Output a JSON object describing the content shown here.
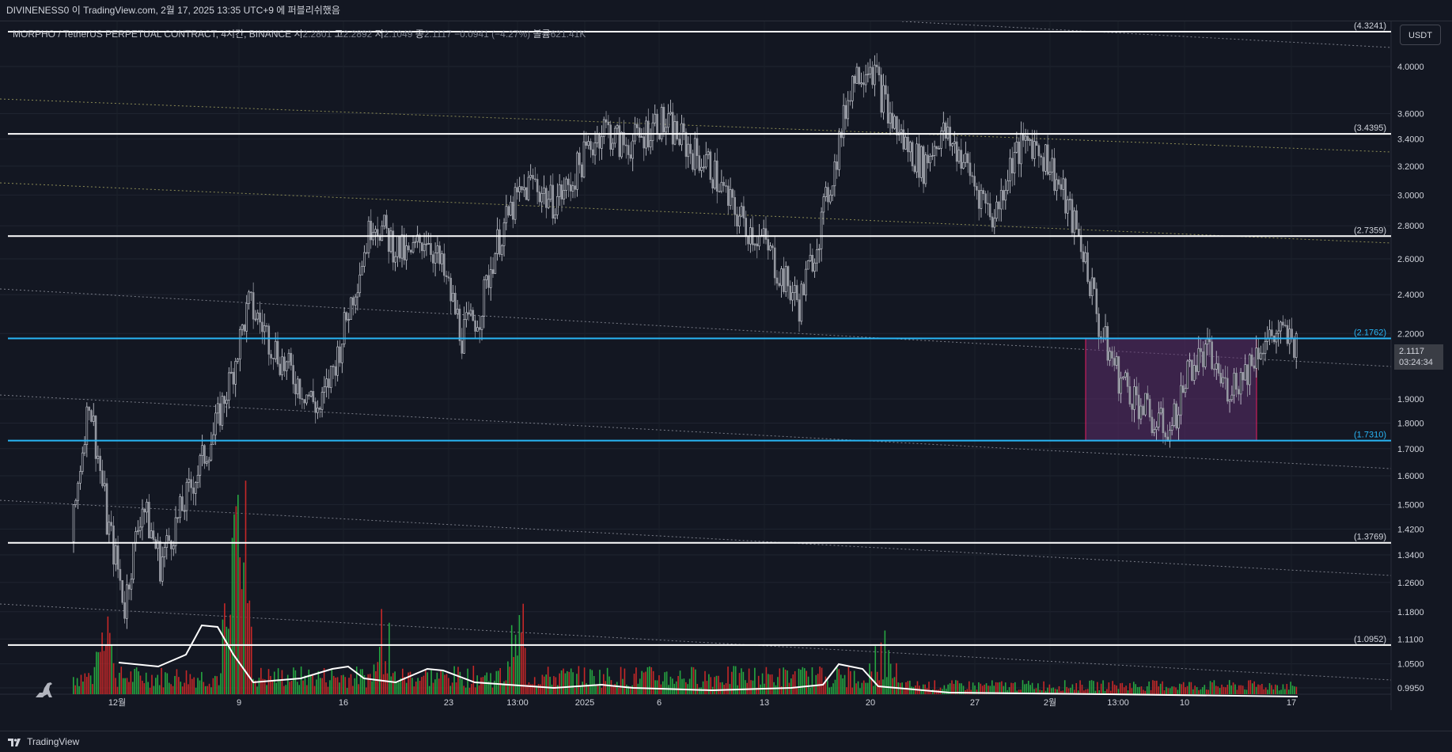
{
  "header": {
    "publish_text": "DIVINENESS0 이 TradingView.com, 2월 17, 2025 13:35 UTC+9 에 퍼블리쉬했음"
  },
  "symbol": {
    "title": "MORPHO / TetherUS PERPETUAL CONTRACT, 4시간, BINANCE",
    "open_label": "시",
    "open_value": "2.2801",
    "high_label": "고",
    "high_value": "2.2892",
    "low_label": "저",
    "low_value": "2.1049",
    "close_label": "종",
    "close_value": "2.1117",
    "change_value": "−0.0941 (−4.27%)",
    "volume_label": "볼륨",
    "volume_value": "621.41K"
  },
  "currency": "USDT",
  "last_price": {
    "value": "2.1117",
    "countdown": "03:24:34"
  },
  "footer": {
    "brand": "TradingView"
  },
  "colors": {
    "background": "#131722",
    "level_white": "#ffffff",
    "level_cyan": "#29b6f6",
    "box_fill": "#5c2d6b",
    "box_border": "#e91e63",
    "candle_up": "#d1d4dc",
    "candle_down": "#9598a1",
    "vol_up": "#26a641",
    "vol_down": "#c62828",
    "vol_ma": "#ffffff"
  },
  "chart_data": {
    "type": "candlestick",
    "price_axis": [
      "4.0000",
      "3.6000",
      "3.4000",
      "3.2000",
      "3.0000",
      "2.8000",
      "2.6000",
      "2.4000",
      "2.2000",
      "1.9000",
      "1.8000",
      "1.7000",
      "1.6000",
      "1.5000",
      "1.4200",
      "1.3400",
      "1.2600",
      "1.1800",
      "1.1100",
      "1.0500",
      "0.9950"
    ],
    "time_axis": [
      "12월",
      "9",
      "16",
      "23",
      "13:00",
      "2025",
      "6",
      "13",
      "20",
      "27",
      "2월",
      "13:00",
      "10",
      "17"
    ],
    "levels": [
      {
        "label": "(4.3241)",
        "value": 4.3241,
        "color": "white"
      },
      {
        "label": "(3.4395)",
        "value": 3.4395,
        "color": "white"
      },
      {
        "label": "(2.7359)",
        "value": 2.7359,
        "color": "white"
      },
      {
        "label": "(2.1762)",
        "value": 2.1762,
        "color": "cyan"
      },
      {
        "label": "(1.7310)",
        "value": 1.731,
        "color": "cyan"
      },
      {
        "label": "(1.3769)",
        "value": 1.3769,
        "color": "white"
      },
      {
        "label": "(1.0952)",
        "value": 1.0952,
        "color": "white"
      }
    ],
    "range_box": {
      "top": 2.1762,
      "bottom": 1.731
    },
    "price_path": [
      1.38,
      1.9,
      1.45,
      1.2,
      1.5,
      1.32,
      1.45,
      1.6,
      1.75,
      2.0,
      2.35,
      2.2,
      2.05,
      1.95,
      1.85,
      2.1,
      2.45,
      2.85,
      2.7,
      2.6,
      2.75,
      2.5,
      2.2,
      2.3,
      2.7,
      2.95,
      3.1,
      2.95,
      3.05,
      3.3,
      3.5,
      3.35,
      3.4,
      3.55,
      3.45,
      3.3,
      3.2,
      2.95,
      2.8,
      2.7,
      2.5,
      2.35,
      2.7,
      3.2,
      3.9,
      4.05,
      3.6,
      3.35,
      3.2,
      3.45,
      3.3,
      3.05,
      2.85,
      3.25,
      3.4,
      3.25,
      2.95,
      2.65,
      2.2,
      2.0,
      1.9,
      1.8,
      1.78,
      2.05,
      2.1,
      1.95,
      2.0,
      2.15,
      2.2,
      2.15
    ]
  }
}
